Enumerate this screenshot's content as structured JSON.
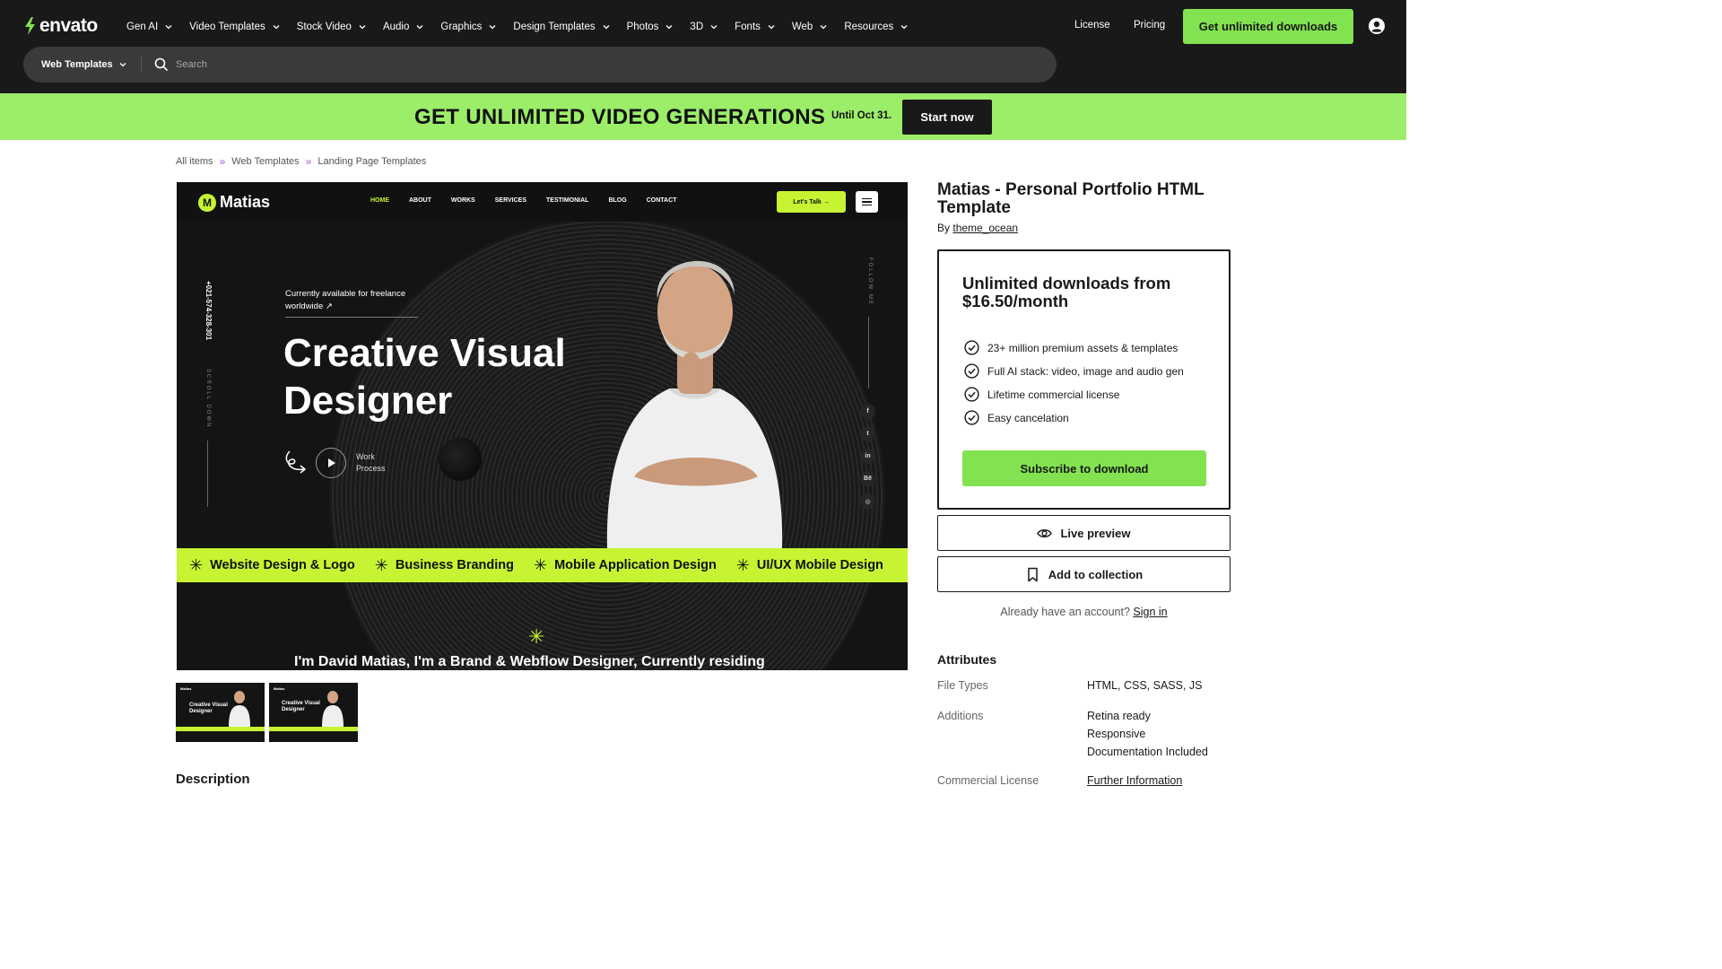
{
  "header": {
    "logo_text": "envato",
    "nav": [
      {
        "label": "Gen AI"
      },
      {
        "label": "Video Templates"
      },
      {
        "label": "Stock Video"
      },
      {
        "label": "Audio"
      },
      {
        "label": "Graphics"
      },
      {
        "label": "Design Templates"
      },
      {
        "label": "Photos"
      },
      {
        "label": "3D"
      },
      {
        "label": "Fonts"
      },
      {
        "label": "Web"
      },
      {
        "label": "Resources"
      }
    ],
    "license": "License",
    "pricing": "Pricing",
    "cta": "Get unlimited downloads",
    "icons": {
      "user": "user-icon",
      "chevron": "chevron-down-icon",
      "logo": "envato-leaf-icon"
    },
    "accent": "#82e250"
  },
  "search": {
    "category": "Web Templates",
    "placeholder": "Search"
  },
  "promo": {
    "title": "GET UNLIMITED VIDEO GENERATIONS",
    "sub": "Until Oct 31.",
    "button": "Start now",
    "bg": "#9cee69"
  },
  "breadcrumb": [
    "All items",
    "Web Templates",
    "Landing Page Templates"
  ],
  "preview": {
    "logo": "Matias",
    "menu": [
      "HOME",
      "ABOUT",
      "WORKS",
      "SERVICES",
      "TESTIMONIAL",
      "BLOG",
      "CONTACT"
    ],
    "talk": "Let's Talk →",
    "phone": "+021-574-328-301",
    "scroll": "SCROLL DOWN",
    "follow": "FOLLOW ME",
    "available_1": "Currently available for freelance",
    "available_2": "worldwide ↗",
    "headline_1": "Creative Visual",
    "headline_2": "Designer",
    "work_1": "Work",
    "work_2": "Process",
    "social": [
      "f",
      "t",
      "in",
      "Bē",
      "◎"
    ],
    "strip": [
      "Website Design & Logo",
      "Business Branding",
      "Mobile Application Design",
      "UI/UX Mobile Design"
    ],
    "bottom_text": "I'm David Matias, I'm a Brand & Webflow Designer, Currently residing",
    "accent": "#c6f432"
  },
  "thumbs": [
    {
      "logo": "Matias",
      "head_1": "Creative Visual",
      "head_2": "Designer"
    },
    {
      "logo": "Matias",
      "head_1": "Creative Visual",
      "head_2": "Designer"
    }
  ],
  "description_heading": "Description",
  "product": {
    "title": "Matias - Personal Portfolio HTML Template",
    "by_label": "By",
    "author": "theme_ocean"
  },
  "plan": {
    "title": "Unlimited downloads from $16.50/month",
    "features": [
      "23+ million premium assets & templates",
      "Full AI stack: video, image and audio gen",
      "Lifetime commercial license",
      "Easy cancelation"
    ],
    "subscribe": "Subscribe to download"
  },
  "actions": {
    "live_preview": "Live preview",
    "add_collection": "Add to collection"
  },
  "account": {
    "text": "Already have an account?",
    "sign_in": "Sign in"
  },
  "attributes": {
    "heading": "Attributes",
    "file_types_label": "File Types",
    "file_types": "HTML, CSS, SASS, JS",
    "additions_label": "Additions",
    "additions": [
      "Retina ready",
      "Responsive",
      "Documentation Included"
    ],
    "commercial_label": "Commercial License",
    "commercial_link": "Further Information"
  }
}
